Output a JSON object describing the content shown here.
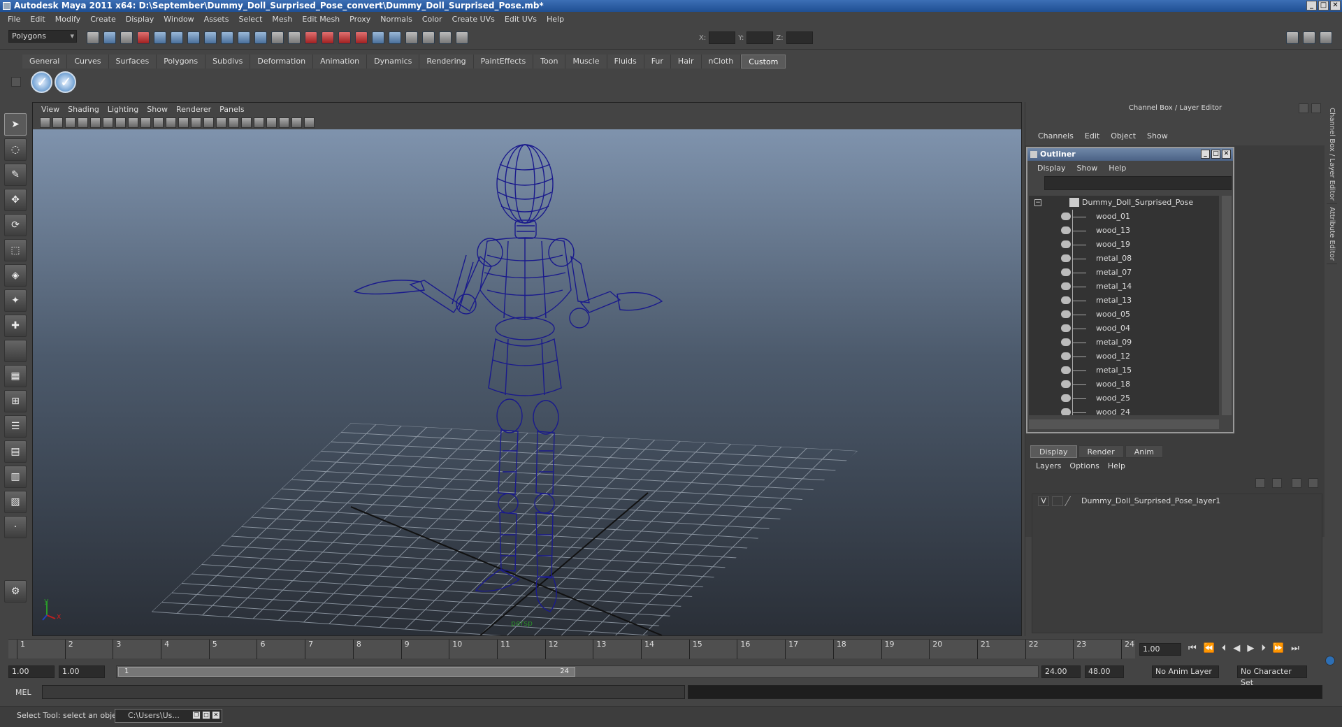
{
  "window": {
    "title": "Autodesk Maya 2011 x64: D:\\September\\Dummy_Doll_Surprised_Pose_convert\\Dummy_Doll_Surprised_Pose.mb*"
  },
  "menus": [
    "File",
    "Edit",
    "Modify",
    "Create",
    "Display",
    "Window",
    "Assets",
    "Select",
    "Mesh",
    "Edit Mesh",
    "Proxy",
    "Normals",
    "Color",
    "Create UVs",
    "Edit UVs",
    "Help"
  ],
  "status": {
    "mode": "Polygons",
    "x_label": "X:",
    "y_label": "Y:",
    "z_label": "Z:"
  },
  "shelf": {
    "tabs": [
      "General",
      "Curves",
      "Surfaces",
      "Polygons",
      "Subdivs",
      "Deformation",
      "Animation",
      "Dynamics",
      "Rendering",
      "PaintEffects",
      "Toon",
      "Muscle",
      "Fluids",
      "Fur",
      "Hair",
      "nCloth",
      "Custom"
    ],
    "active": "Custom"
  },
  "viewport": {
    "menus": [
      "View",
      "Shading",
      "Lighting",
      "Show",
      "Renderer",
      "Panels"
    ],
    "camera_label": "persp",
    "axis_y": "y",
    "axis_x": "x"
  },
  "channel_box": {
    "title": "Channel Box / Layer Editor",
    "menus": [
      "Channels",
      "Edit",
      "Object",
      "Show"
    ]
  },
  "side_tabs": [
    "Channel Box / Layer Editor",
    "Attribute Editor"
  ],
  "outliner": {
    "title": "Outliner",
    "menus": [
      "Display",
      "Show",
      "Help"
    ],
    "root": "Dummy_Doll_Surprised_Pose",
    "items": [
      "wood_01",
      "wood_13",
      "wood_19",
      "metal_08",
      "metal_07",
      "metal_14",
      "metal_13",
      "wood_05",
      "wood_04",
      "metal_09",
      "wood_12",
      "metal_15",
      "wood_18",
      "wood_25",
      "wood_24"
    ]
  },
  "layer_editor": {
    "tabs": [
      "Display",
      "Render",
      "Anim"
    ],
    "active": "Display",
    "menus": [
      "Layers",
      "Options",
      "Help"
    ],
    "layers": [
      {
        "visible": "V",
        "name": "Dummy_Doll_Surprised_Pose_layer1"
      }
    ]
  },
  "timeline": {
    "ticks": [
      "1",
      "2",
      "3",
      "4",
      "5",
      "6",
      "7",
      "8",
      "9",
      "10",
      "11",
      "12",
      "13",
      "14",
      "15",
      "16",
      "17",
      "18",
      "19",
      "20",
      "21",
      "22",
      "23",
      "24"
    ],
    "current_frame": "1.00",
    "start": "1.00",
    "start_playback": "1.00",
    "range_start_label": "1",
    "range_end_label": "24",
    "end_playback": "24.00",
    "end": "48.00",
    "anim_layer": "No Anim Layer",
    "character_set": "No Character Set"
  },
  "command_line": {
    "label": "MEL"
  },
  "help_line": {
    "text": "Select Tool: select an object",
    "task_label": "C:\\Users\\Us..."
  },
  "colors": {
    "wireframe": "#1a1a8c",
    "accent": "#3c6fb5"
  }
}
